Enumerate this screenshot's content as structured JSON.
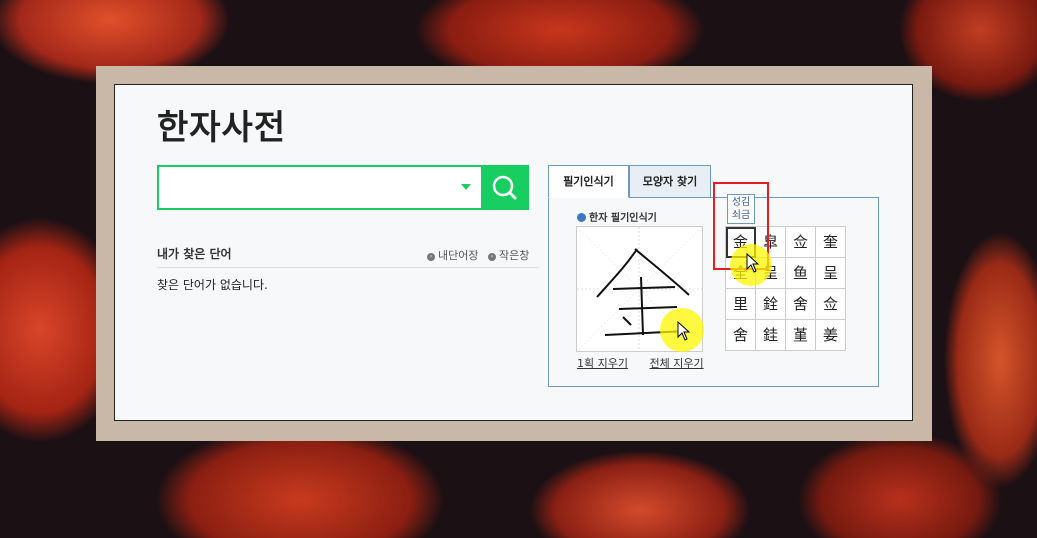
{
  "page": {
    "title": "한자사전"
  },
  "search": {
    "value": "",
    "placeholder": ""
  },
  "my_searches": {
    "label": "내가 찾은 단어",
    "links": [
      "내단어장",
      "작은창"
    ],
    "empty_text": "찾은 단어가 없습니다."
  },
  "handwriting": {
    "tabs": [
      "필기인식기",
      "모양자 찾기"
    ],
    "active_tab": 0,
    "section_label": "한자 필기인식기",
    "clear_one_label": "1획 지우기",
    "clear_all_label": "전체 지우기",
    "candidates": [
      [
        "金",
        "皐",
        "佥",
        "奎"
      ],
      [
        "全",
        "呈",
        "鱼",
        "呈"
      ],
      [
        "里",
        "銓",
        "舍",
        "佥"
      ],
      [
        "舍",
        "銈",
        "堇",
        "姜"
      ]
    ],
    "selected_index": 0,
    "tooltip_lines": [
      "성김",
      "쇠금"
    ]
  },
  "colors": {
    "accent_green": "#19ce60",
    "tab_border": "#6f98bd",
    "highlight_red": "#e02020",
    "cursor_highlight": "#fff500"
  },
  "icons": {
    "search": "search-icon",
    "dropdown": "chevron-down-icon"
  }
}
